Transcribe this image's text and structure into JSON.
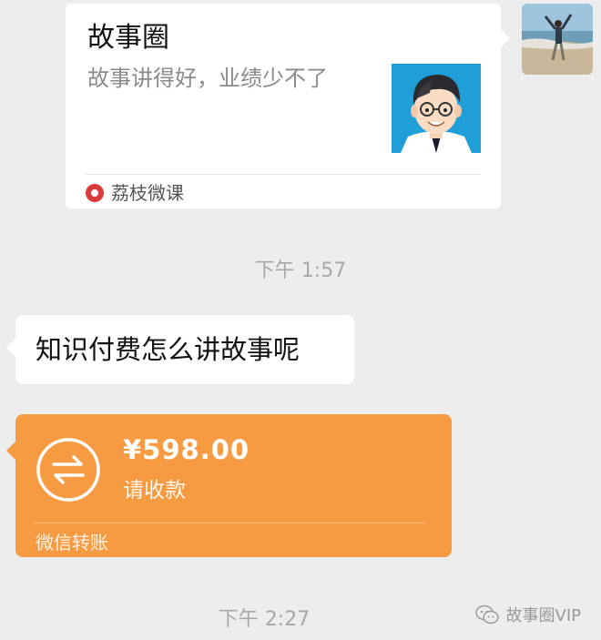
{
  "shared_link": {
    "title": "故事圈",
    "description": "故事讲得好，业绩少不了",
    "source_name": "荔枝微课",
    "thumbnail_icon": "cartoon-man-with-glasses"
  },
  "self_avatar_icon": "beach-photo-avatar",
  "timestamps": [
    "下午 1:57",
    "下午 2:27"
  ],
  "incoming_message": {
    "text": "知识付费怎么讲故事呢"
  },
  "transfer": {
    "amount": "¥598.00",
    "status": "请收款",
    "label": "微信转账",
    "icon": "transfer-arrows-icon",
    "color": "#f79b43"
  },
  "watermark": {
    "text": "故事圈VIP"
  }
}
